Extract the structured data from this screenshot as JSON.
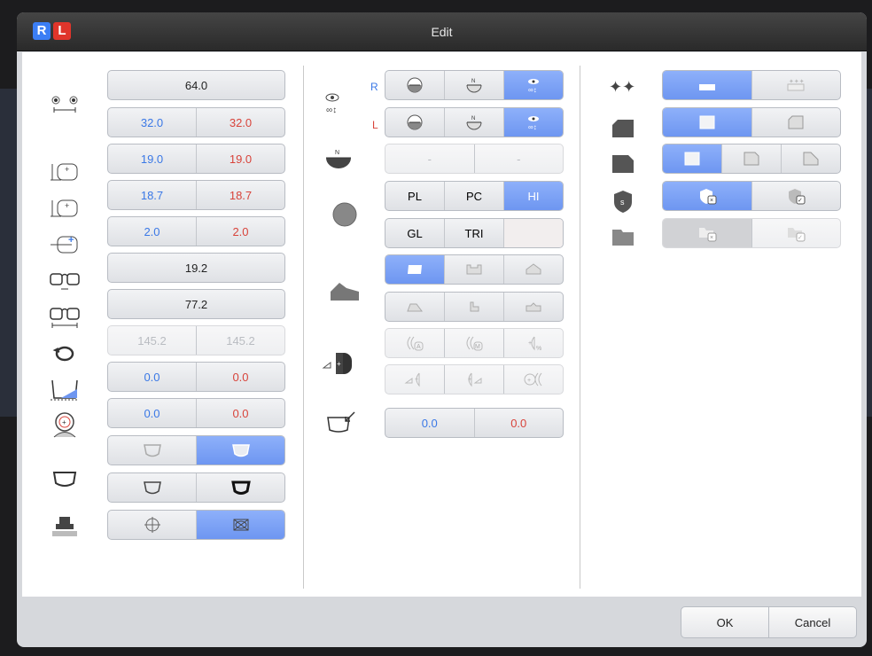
{
  "window": {
    "title": "Edit",
    "badge_r": "R",
    "badge_l": "L"
  },
  "col1": {
    "pd_total": "64.0",
    "pd_r": "32.0",
    "pd_l": "32.0",
    "height1_r": "19.0",
    "height1_l": "19.0",
    "height2_r": "18.7",
    "height2_l": "18.7",
    "offset_r": "2.0",
    "offset_l": "2.0",
    "dbl": "19.2",
    "frame_width": "77.2",
    "circ_r": "145.2",
    "circ_l": "145.2",
    "tilt_r": "0.0",
    "tilt_l": "0.0",
    "face_r": "0.0",
    "face_l": "0.0"
  },
  "col2": {
    "r_label": "R",
    "l_label": "L",
    "dash_1": "-",
    "dash_2": "-",
    "material_1": [
      "PL",
      "PC",
      "HI"
    ],
    "material_2": [
      "GL",
      "TRI",
      ""
    ],
    "size_r": "0.0",
    "size_l": "0.0"
  },
  "footer": {
    "ok": "OK",
    "cancel": "Cancel"
  },
  "colors": {
    "accent": "#7a9ff5",
    "right": "#3a78e6",
    "left": "#d8433a"
  }
}
